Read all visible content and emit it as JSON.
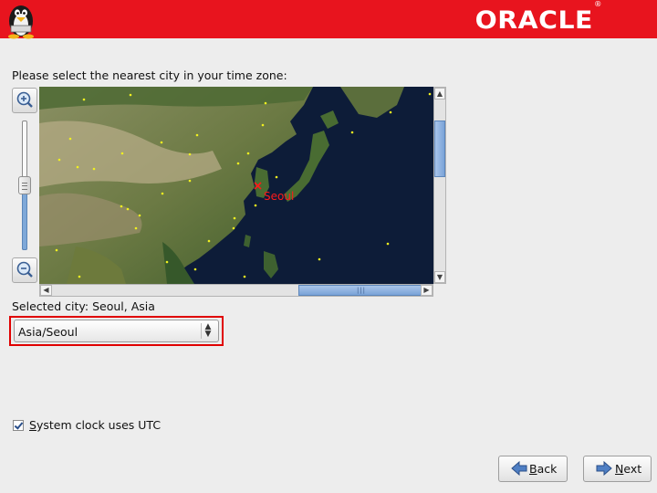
{
  "header": {
    "brand": "ORACLE",
    "brand_mark": "®",
    "logo_icon": "tux-penguin-icon",
    "background_color": "#e8141e"
  },
  "prompt": "Please select the nearest city in your time zone:",
  "map": {
    "region": "East Asia",
    "marked_city": "Seoul",
    "marker_color": "#ff1a1a",
    "city_dot_color": "#f0f020"
  },
  "zoom": {
    "zoom_in_icon": "zoom-in-icon",
    "zoom_out_icon": "zoom-out-icon"
  },
  "selected_city": {
    "label": "Selected city: Seoul, Asia"
  },
  "timezone_select": {
    "value": "Asia/Seoul",
    "highlight_color": "#e00000"
  },
  "utc_checkbox": {
    "label_prefix": "S",
    "label_rest": "ystem clock uses UTC",
    "checked": true
  },
  "buttons": {
    "back_mnemonic": "B",
    "back_rest": "ack",
    "next_mnemonic": "N",
    "next_rest": "ext"
  }
}
